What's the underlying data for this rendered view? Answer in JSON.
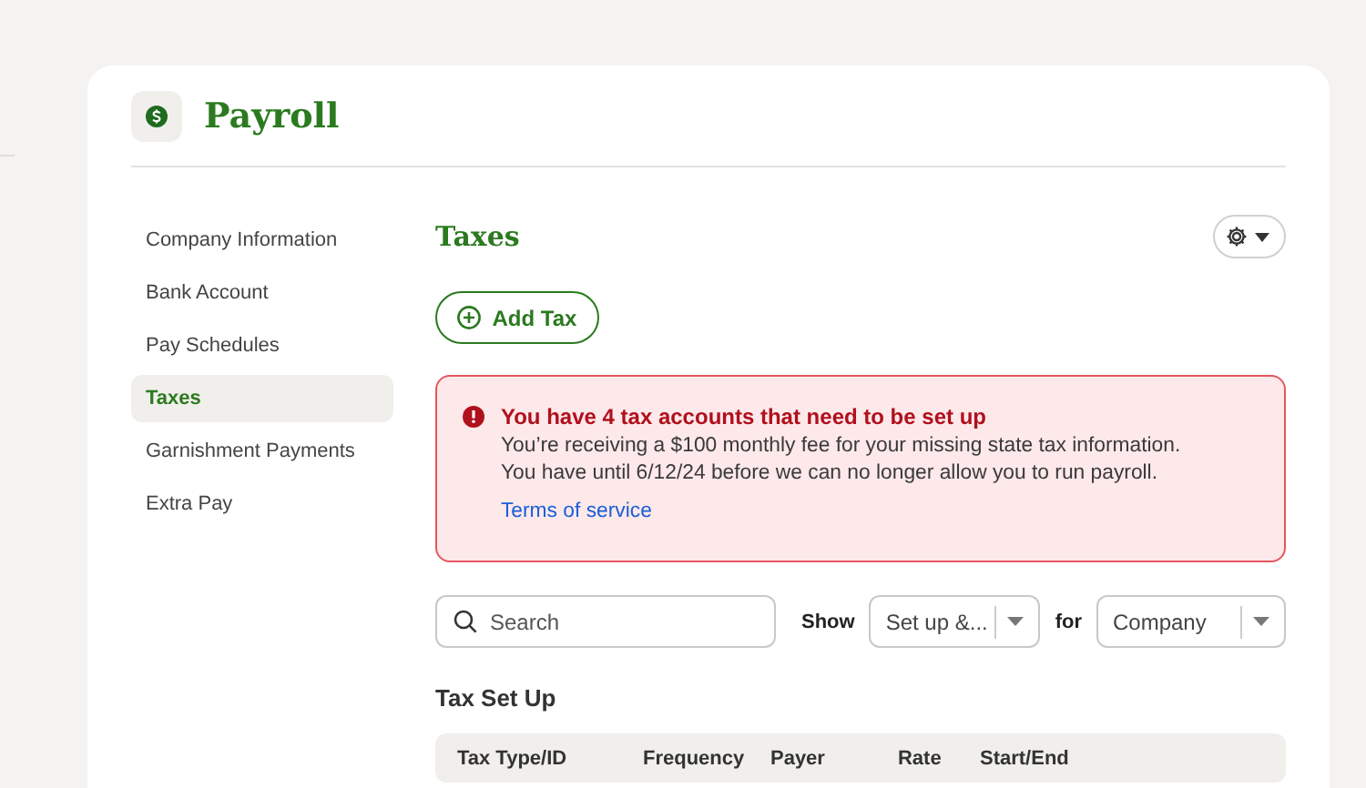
{
  "header": {
    "title": "Payroll"
  },
  "sidebar": {
    "items": [
      {
        "label": "Company Information",
        "selected": false
      },
      {
        "label": "Bank Account",
        "selected": false
      },
      {
        "label": "Pay Schedules",
        "selected": false
      },
      {
        "label": "Taxes",
        "selected": true
      },
      {
        "label": "Garnishment Payments",
        "selected": false
      },
      {
        "label": "Extra Pay",
        "selected": false
      }
    ]
  },
  "content": {
    "title": "Taxes",
    "add_button": "Add Tax",
    "alert": {
      "title": "You have 4 tax accounts that need to be set up",
      "lines": [
        "You’re receiving a $100 monthly fee for your missing state tax information.",
        "You have until 6/12/24 before we can no longer allow you to run payroll."
      ],
      "link": "Terms of service"
    },
    "filters": {
      "search": {
        "placeholder": "Search"
      },
      "show_label": "Show",
      "show_value": "Set up &...",
      "for_label": "for",
      "for_value": "Company"
    },
    "section_title": "Tax Set Up",
    "table": {
      "columns": [
        "Tax Type/ID",
        "Frequency",
        "Payer",
        "Rate",
        "Start/End"
      ]
    }
  }
}
